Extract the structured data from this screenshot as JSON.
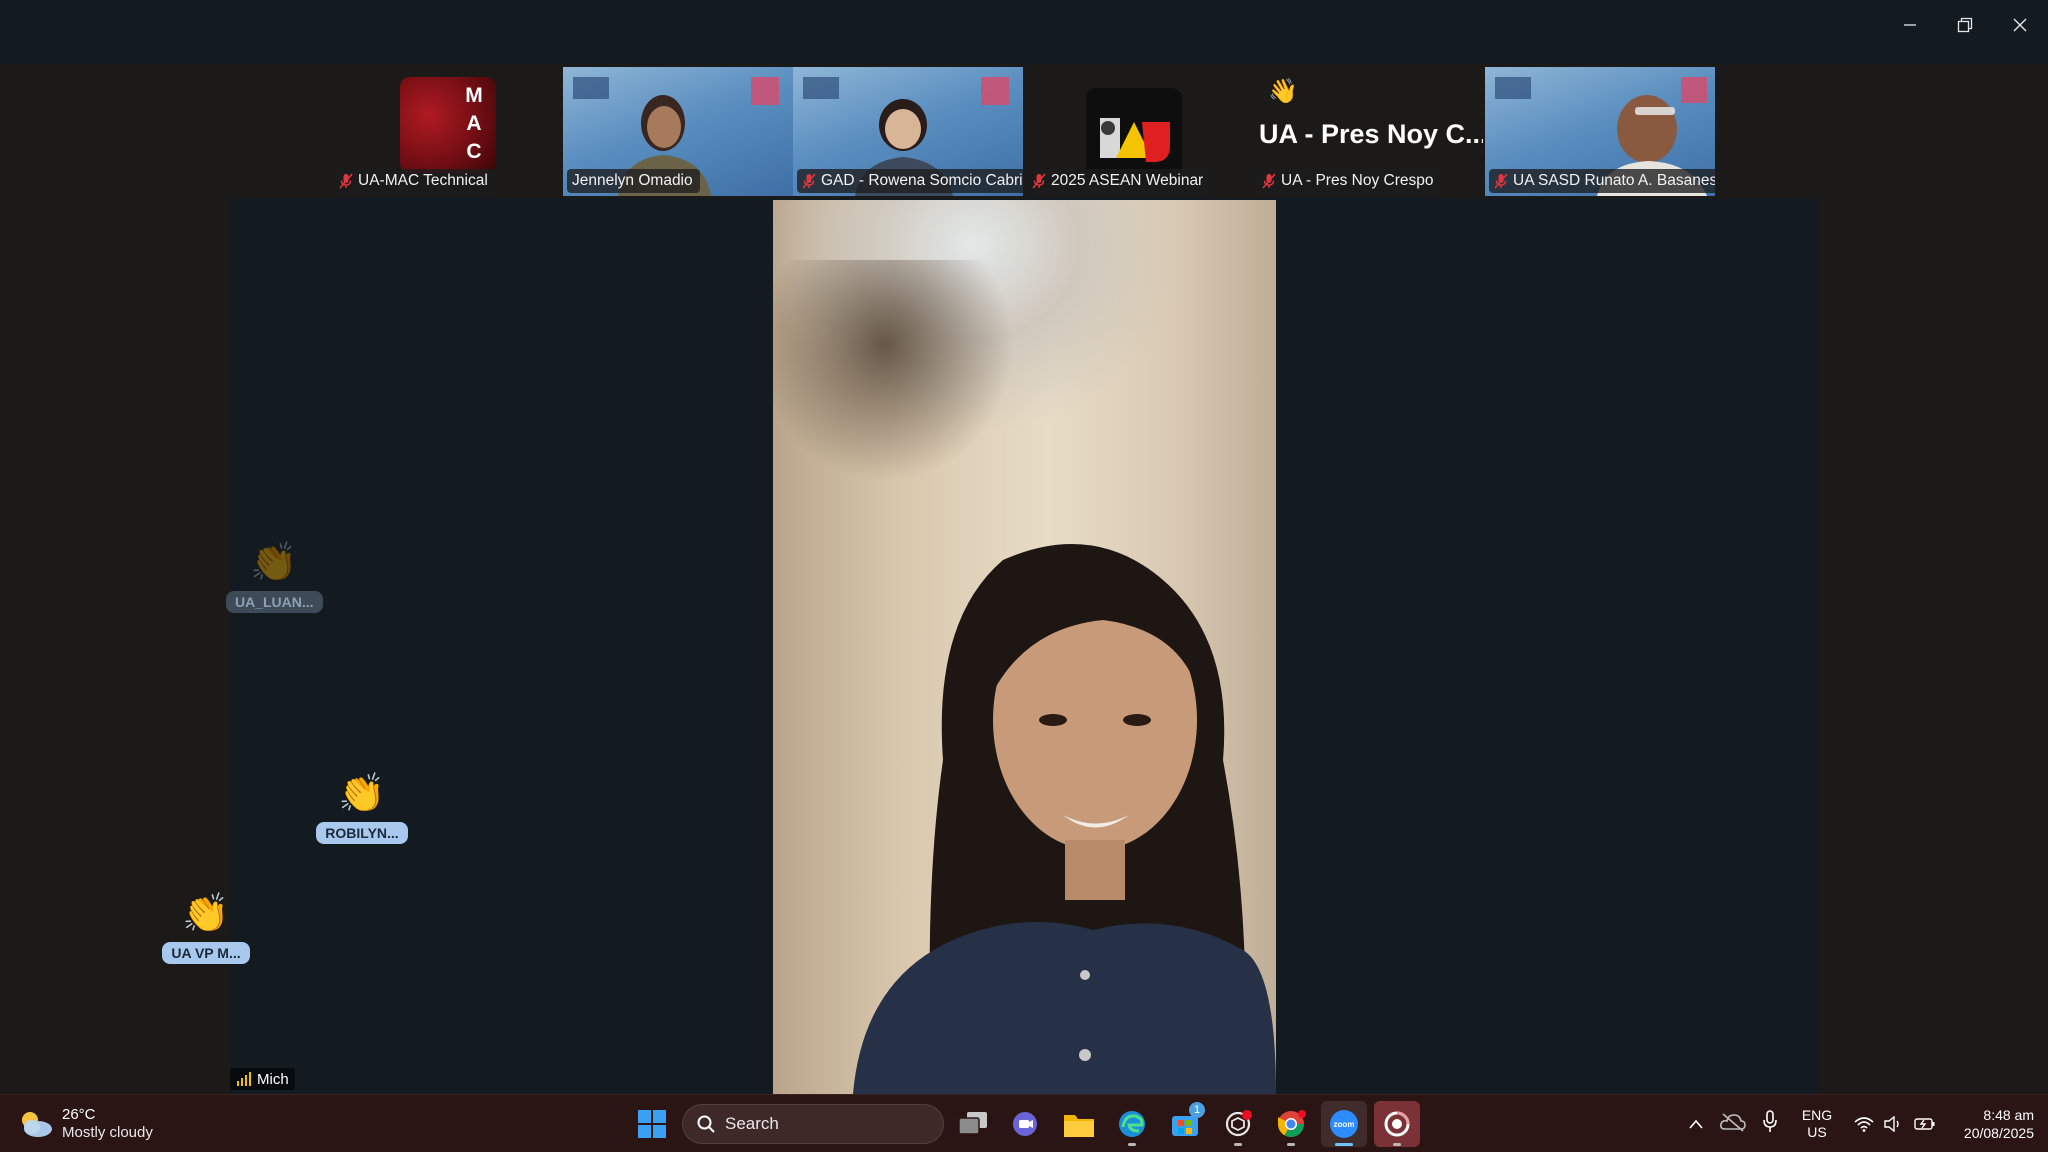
{
  "window": {
    "controls": {
      "minimize": "minimize-icon",
      "restore": "restore-icon",
      "close": "close-icon"
    }
  },
  "gallery": {
    "tiles": [
      {
        "name": "UA-MAC Technical",
        "avatar_text": [
          "M",
          "A",
          "C"
        ],
        "muted": true
      },
      {
        "name": "Jennelyn Omadio",
        "muted": false,
        "video": true
      },
      {
        "name": "GAD - Rowena Somcio Cabri...",
        "muted": true,
        "video": true
      },
      {
        "name": "2025 ASEAN Webinar",
        "muted": true
      },
      {
        "name": "UA - Pres Noy Crespo",
        "display_name": "UA - Pres Noy C...",
        "muted": true,
        "reaction": "wave-icon"
      },
      {
        "name": "UA SASD Runato A. Basanes",
        "muted": true,
        "video": true
      }
    ]
  },
  "reactions": [
    {
      "label": "UA_LUAN...",
      "emoji": "👏"
    },
    {
      "label": "ROBILYN...",
      "emoji": "👏"
    },
    {
      "label": "UA VP M...",
      "emoji": "👏"
    }
  ],
  "stage": {
    "active_speaker_label": "Mich"
  },
  "taskbar": {
    "weather": {
      "temp": "26°C",
      "condition": "Mostly cloudy"
    },
    "search_placeholder": "Search",
    "store_badge": "1",
    "lang_top": "ENG",
    "lang_bottom": "US",
    "time": "8:48 am",
    "date": "20/08/2025"
  }
}
